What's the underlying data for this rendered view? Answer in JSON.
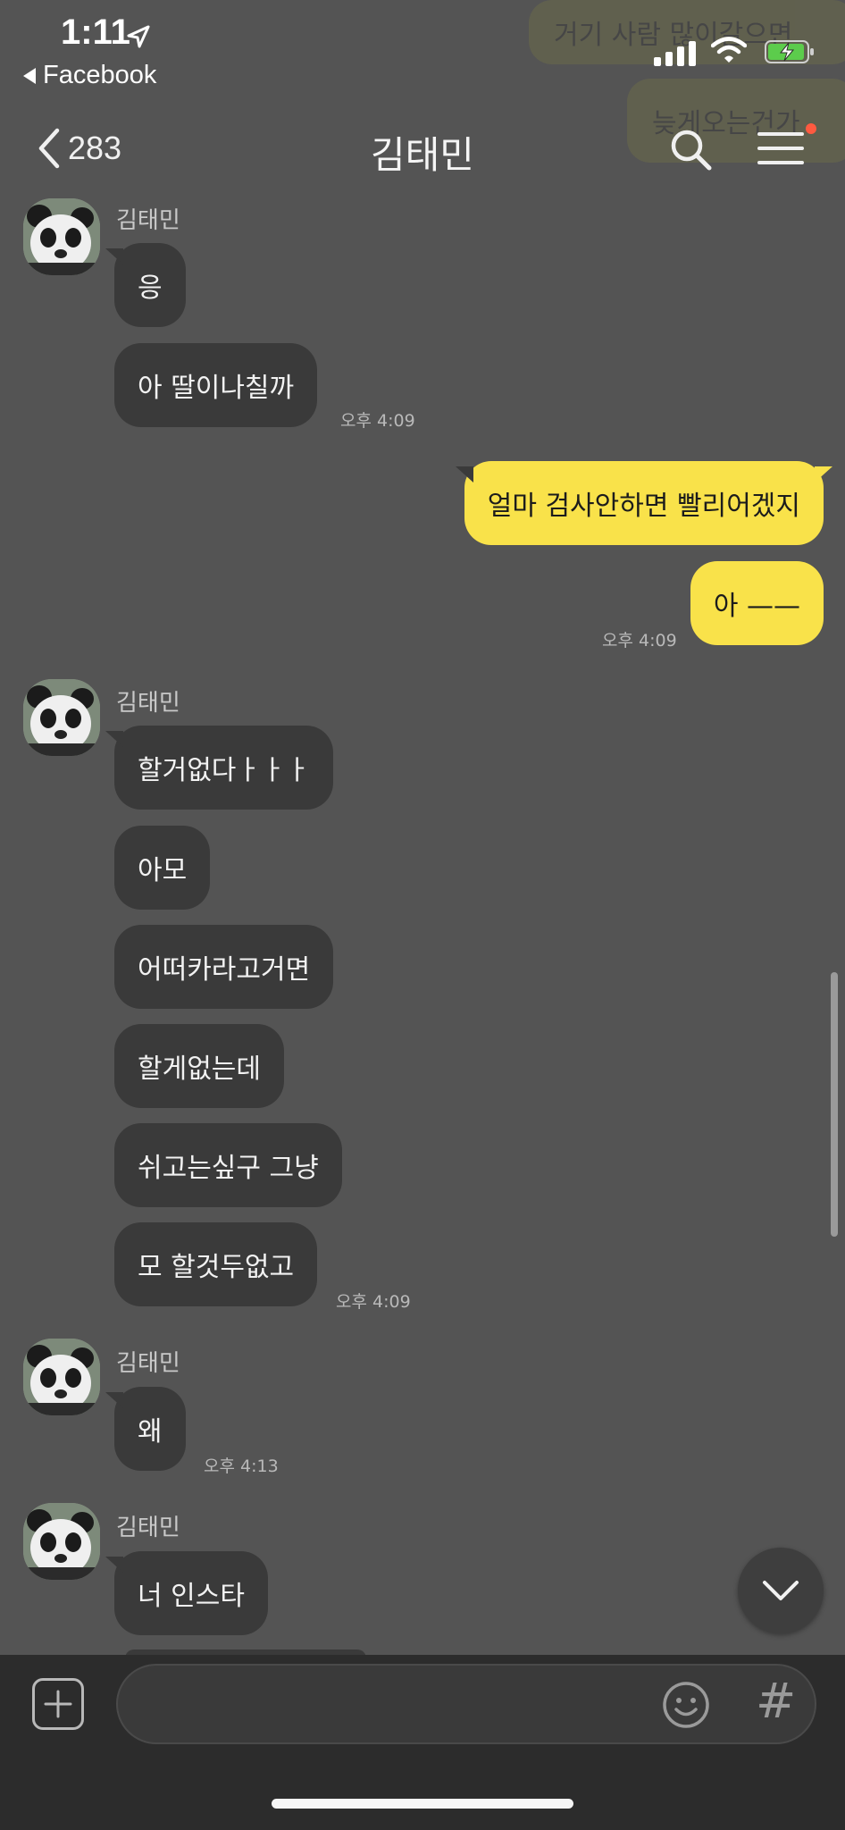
{
  "status_bar": {
    "time": "1:11",
    "back_app": "Facebook"
  },
  "ghost_bubbles": [
    {
      "text": "거기 사람 많이갈으면"
    },
    {
      "text": "늦게오는건가"
    }
  ],
  "header": {
    "back_count": "283",
    "title": "김태민"
  },
  "groups": [
    {
      "sender": "김태민",
      "messages": [
        "응",
        "아 딸이나칠까"
      ],
      "time": "오후 4:09"
    },
    {
      "sender": "me",
      "messages": [
        "얼마 검사안하면 빨리어겠지",
        "아 ——"
      ],
      "time": "오후 4:09"
    },
    {
      "sender": "김태민",
      "messages": [
        "할거없다ㅏㅏㅏ",
        "아모",
        "어떠카라고거면",
        "할게없는데",
        "쉬고는싶구 그냥",
        "모 할것두없고"
      ],
      "time": "오후 4:09"
    },
    {
      "sender": "김태민",
      "messages": [
        "왜"
      ],
      "time": "오후 4:13"
    },
    {
      "sender": "김태민",
      "messages": [
        "너 인스타"
      ],
      "time": ""
    }
  ],
  "input": {
    "placeholder": ""
  },
  "icons": {
    "back": "chevron-left-icon",
    "search": "search-icon",
    "menu": "menu-icon",
    "add": "plus-icon",
    "emoji": "emoji-icon",
    "hashtag": "hashtag-icon",
    "scroll_down": "chevron-down-icon"
  },
  "colors": {
    "background": "#545454",
    "my_bubble": "#f9e24a",
    "their_bubble": "#3a3a3a",
    "notification_dot": "#ff5a40"
  }
}
